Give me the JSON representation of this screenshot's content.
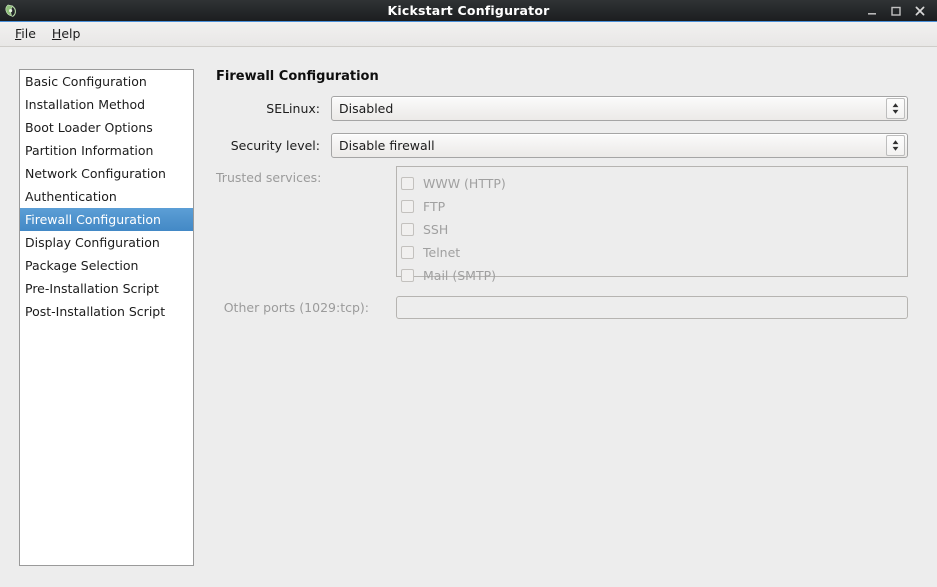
{
  "window": {
    "title": "Kickstart Configurator",
    "app_icon": "app-icon",
    "controls": {
      "minimize": "minimize-icon",
      "maximize": "maximize-icon",
      "close": "close-icon"
    }
  },
  "menubar": {
    "items": [
      {
        "label": "File",
        "mnemonic": "F",
        "rest": "ile"
      },
      {
        "label": "Help",
        "mnemonic": "H",
        "rest": "elp"
      }
    ]
  },
  "sidebar": {
    "items": [
      {
        "label": "Basic Configuration",
        "selected": false
      },
      {
        "label": "Installation Method",
        "selected": false
      },
      {
        "label": "Boot Loader Options",
        "selected": false
      },
      {
        "label": "Partition Information",
        "selected": false
      },
      {
        "label": "Network Configuration",
        "selected": false
      },
      {
        "label": "Authentication",
        "selected": false
      },
      {
        "label": "Firewall Configuration",
        "selected": true
      },
      {
        "label": "Display Configuration",
        "selected": false
      },
      {
        "label": "Package Selection",
        "selected": false
      },
      {
        "label": "Pre-Installation Script",
        "selected": false
      },
      {
        "label": "Post-Installation Script",
        "selected": false
      }
    ],
    "selected_index": 6,
    "selection_color": "#4f93cd"
  },
  "main": {
    "heading": "Firewall Configuration",
    "selinux": {
      "label": "SELinux:",
      "value": "Disabled",
      "enabled": true
    },
    "security_level": {
      "label": "Security level:",
      "value": "Disable firewall",
      "enabled": true
    },
    "trusted_services": {
      "label": "Trusted services:",
      "enabled": false,
      "options": [
        {
          "label": "WWW (HTTP)",
          "checked": false
        },
        {
          "label": "FTP",
          "checked": false
        },
        {
          "label": "SSH",
          "checked": false
        },
        {
          "label": "Telnet",
          "checked": false
        },
        {
          "label": "Mail (SMTP)",
          "checked": false
        }
      ]
    },
    "other_ports": {
      "label": "Other ports (1029:tcp):",
      "value": "",
      "enabled": false
    }
  }
}
